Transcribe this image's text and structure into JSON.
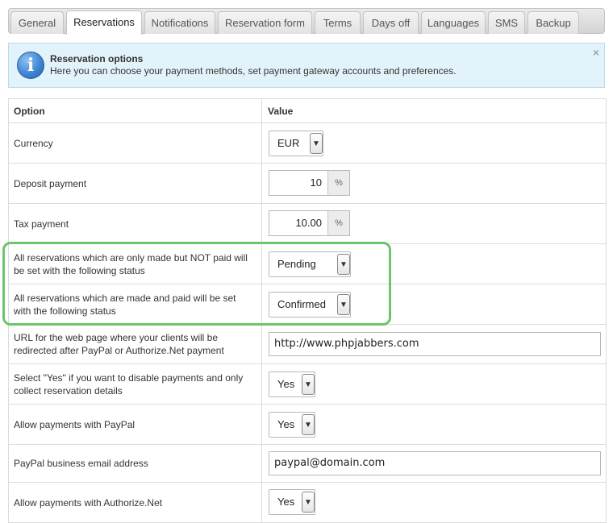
{
  "tabs": [
    {
      "label": "General"
    },
    {
      "label": "Reservations",
      "active": true
    },
    {
      "label": "Notifications"
    },
    {
      "label": "Reservation form"
    },
    {
      "label": "Terms"
    },
    {
      "label": "Days off"
    },
    {
      "label": "Languages"
    },
    {
      "label": "SMS"
    },
    {
      "label": "Backup"
    }
  ],
  "info": {
    "icon": "info-icon",
    "title": "Reservation options",
    "description": "Here you can choose your payment methods, set payment gateway accounts and preferences.",
    "close": "×"
  },
  "table": {
    "header_option": "Option",
    "header_value": "Value",
    "rows": [
      {
        "label": "Currency",
        "type": "select",
        "value": "EUR"
      },
      {
        "label": "Deposit payment",
        "type": "number",
        "value": "10",
        "unit": "%"
      },
      {
        "label": "Tax payment",
        "type": "number",
        "value": "10.00",
        "unit": "%"
      },
      {
        "label": "All reservations which are only made but NOT paid will be set with the following status",
        "type": "select",
        "value": "Pending"
      },
      {
        "label": "All reservations which are made and paid will be set with the following status",
        "type": "select",
        "value": "Confirmed"
      },
      {
        "label": "URL for the web page where your clients will be redirected after PayPal or Authorize.Net payment",
        "type": "text",
        "value": "http://www.phpjabbers.com"
      },
      {
        "label": "Select \"Yes\" if you want to disable payments and only collect reservation details",
        "type": "select",
        "value": "Yes"
      },
      {
        "label": "Allow payments with PayPal",
        "type": "select",
        "value": "Yes"
      },
      {
        "label": "PayPal business email address",
        "type": "text",
        "value": "paypal@domain.com"
      },
      {
        "label": "Allow payments with Authorize.Net",
        "type": "select",
        "value": "Yes"
      }
    ]
  },
  "colors": {
    "highlight": "#6dc46a",
    "info_bg": "#e3f3fb"
  }
}
